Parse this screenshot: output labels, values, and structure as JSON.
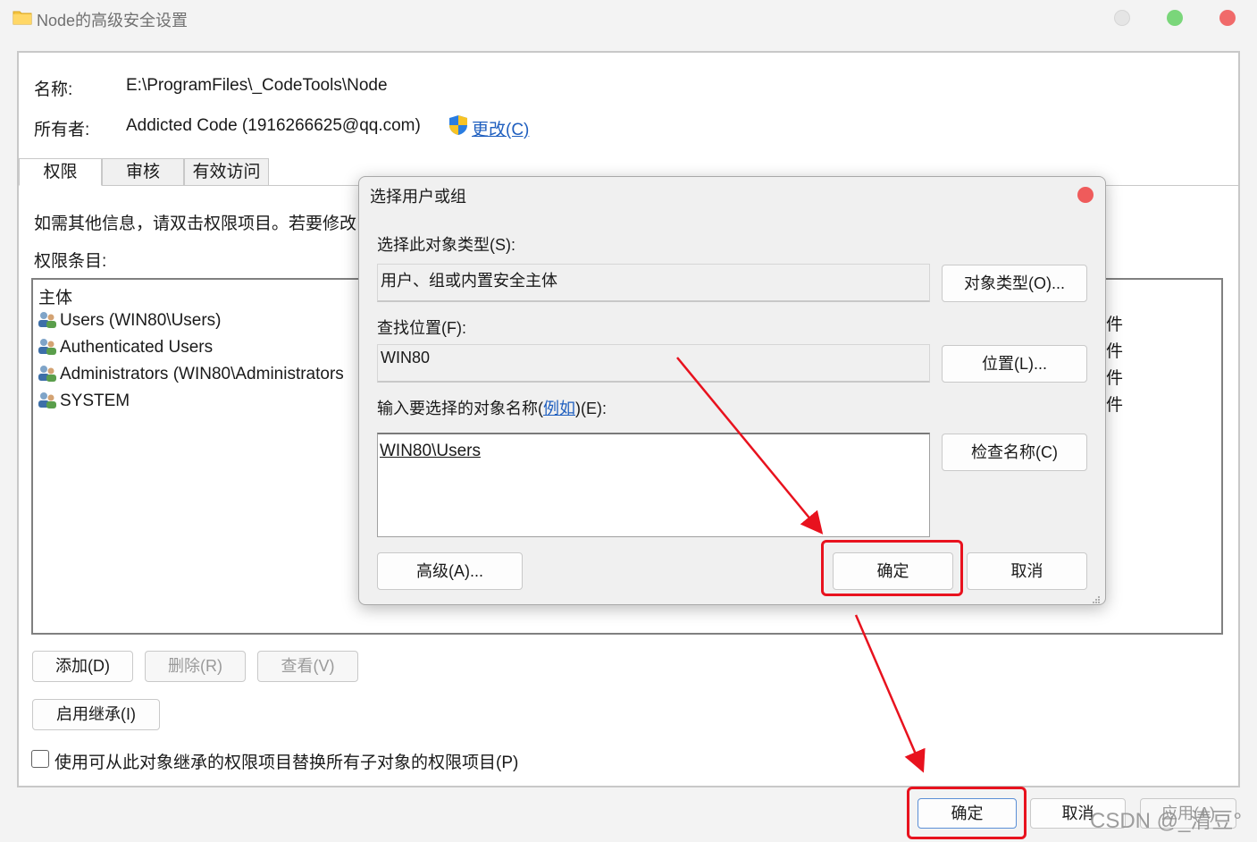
{
  "window": {
    "title": "Node的高级安全设置"
  },
  "info": {
    "name_label": "名称:",
    "name_value": "E:\\ProgramFiles\\_CodeTools\\Node",
    "owner_label": "所有者:",
    "owner_value": "Addicted Code (1916266625@qq.com)",
    "change_link": "更改(C)"
  },
  "tabs": [
    {
      "label": "权限"
    },
    {
      "label": "审核"
    },
    {
      "label": "有效访问"
    }
  ],
  "main": {
    "instruction": "如需其他信息，请双击权限项目。若要修改",
    "entries_label": "权限条目:",
    "column_principal": "主体",
    "entries": [
      {
        "principal": "Users (WIN80\\Users)"
      },
      {
        "principal": "Authenticated Users"
      },
      {
        "principal": "Administrators (WIN80\\Administrators"
      },
      {
        "principal": "SYSTEM"
      }
    ],
    "right_col_fragments": [
      "件",
      "件",
      "件",
      "件"
    ],
    "add_button": "添加(D)",
    "remove_button": "删除(R)",
    "view_button": "查看(V)",
    "enable_inheritance_button": "启用继承(I)",
    "replace_checkbox_label": "使用可从此对象继承的权限项目替换所有子对象的权限项目(P)"
  },
  "footer": {
    "ok_button": "确定",
    "cancel_button": "取消",
    "apply_button": "应用(A)"
  },
  "dialog": {
    "title": "选择用户或组",
    "object_type_label": "选择此对象类型(S):",
    "object_type_value": "用户、组或内置安全主体",
    "object_type_button": "对象类型(O)...",
    "location_label": "查找位置(F):",
    "location_value": "WIN80",
    "location_button": "位置(L)...",
    "enter_label_prefix": "输入要选择的对象名称(",
    "enter_label_link": "例如",
    "enter_label_suffix": ")(E):",
    "enter_value": "WIN80\\Users",
    "check_names_button": "检查名称(C)",
    "advanced_button": "高级(A)...",
    "ok_button": "确定",
    "cancel_button": "取消"
  },
  "watermark": "CSDN @_清豆°",
  "colors": {
    "highlight_red": "#e8121e",
    "link_blue": "#1f5fbf"
  }
}
